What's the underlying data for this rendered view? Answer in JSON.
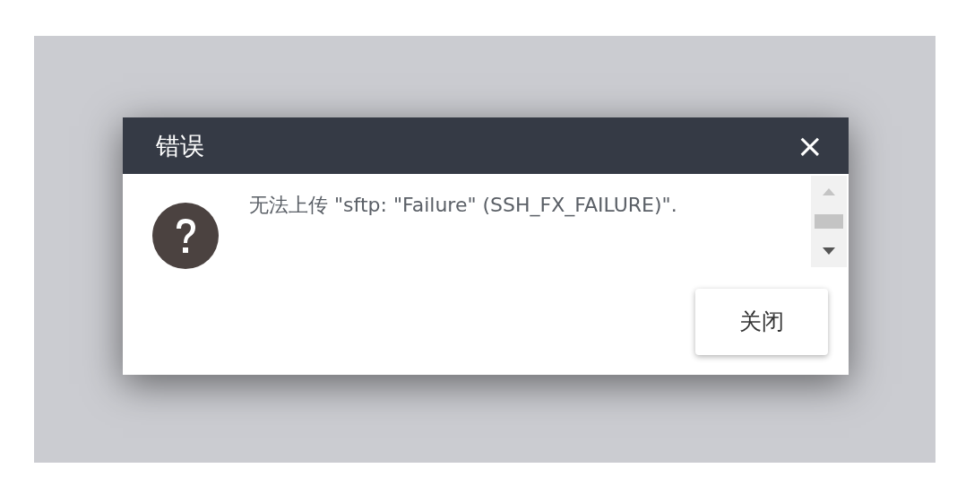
{
  "dialog": {
    "title": "错误",
    "close": "×",
    "message": "无法上传 \"sftp: \"Failure\" (SSH_FX_FAILURE)\".",
    "buttons": [
      "关闭"
    ]
  }
}
